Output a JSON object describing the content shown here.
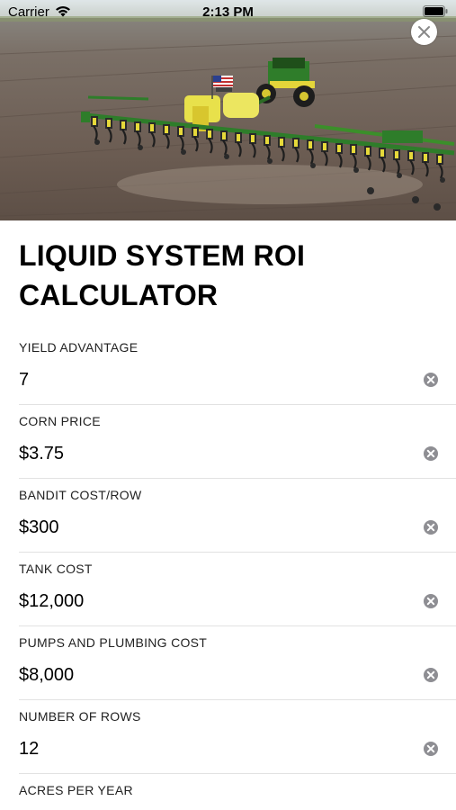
{
  "status_bar": {
    "carrier": "Carrier",
    "time": "2:13 PM",
    "icons": [
      "wifi-icon",
      "battery-icon"
    ]
  },
  "hero": {
    "icon": "planter-tractor-photo"
  },
  "close_icon": "close-icon",
  "title": "LIQUID SYSTEM ROI CALCULATOR",
  "fields": [
    {
      "label": "YIELD ADVANTAGE",
      "value": "7"
    },
    {
      "label": "CORN PRICE",
      "value": "$3.75"
    },
    {
      "label": "BANDIT COST/ROW",
      "value": "$300"
    },
    {
      "label": "TANK COST",
      "value": "$12,000"
    },
    {
      "label": "PUMPS AND PLUMBING COST",
      "value": "$8,000"
    },
    {
      "label": "NUMBER OF ROWS",
      "value": "12"
    },
    {
      "label": "ACRES PER YEAR",
      "value": ""
    }
  ],
  "colors": {
    "accent_green": "#3b8f2a",
    "planter_yellow": "#e6d93a",
    "clear_icon_gray": "#8e8e93"
  }
}
